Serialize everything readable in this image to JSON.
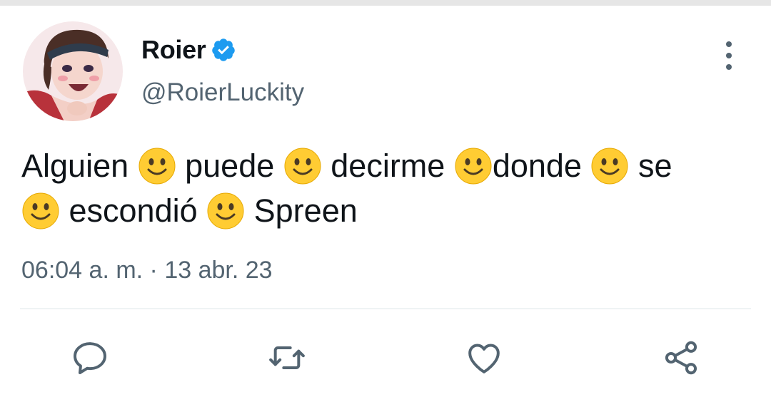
{
  "author": {
    "display_name": "Roier",
    "handle": "@RoierLuckity",
    "verified": true,
    "avatar_icon": "avatar-portrait"
  },
  "tweet": {
    "segments": [
      {
        "type": "text",
        "value": "Alguien "
      },
      {
        "type": "emoji",
        "value": "🙂"
      },
      {
        "type": "text",
        "value": " puede "
      },
      {
        "type": "emoji",
        "value": "🙂"
      },
      {
        "type": "text",
        "value": " decirme "
      },
      {
        "type": "emoji",
        "value": "🙂"
      },
      {
        "type": "text",
        "value": "donde "
      },
      {
        "type": "emoji",
        "value": "🙂"
      },
      {
        "type": "text",
        "value": " se"
      },
      {
        "type": "emoji",
        "value": "🙂"
      },
      {
        "type": "text",
        "value": " escondió "
      },
      {
        "type": "emoji",
        "value": "🙂"
      },
      {
        "type": "text",
        "value": " Spreen"
      }
    ],
    "timestamp": "06:04 a. m. · 13 abr. 23"
  },
  "actions": [
    {
      "name": "reply",
      "icon": "reply-icon"
    },
    {
      "name": "retweet",
      "icon": "retweet-icon"
    },
    {
      "name": "like",
      "icon": "heart-icon"
    },
    {
      "name": "share",
      "icon": "share-icon"
    }
  ],
  "colors": {
    "text": "#0f1419",
    "secondary": "#536471",
    "verified": "#1d9bf0",
    "divider": "#eff3f4"
  }
}
